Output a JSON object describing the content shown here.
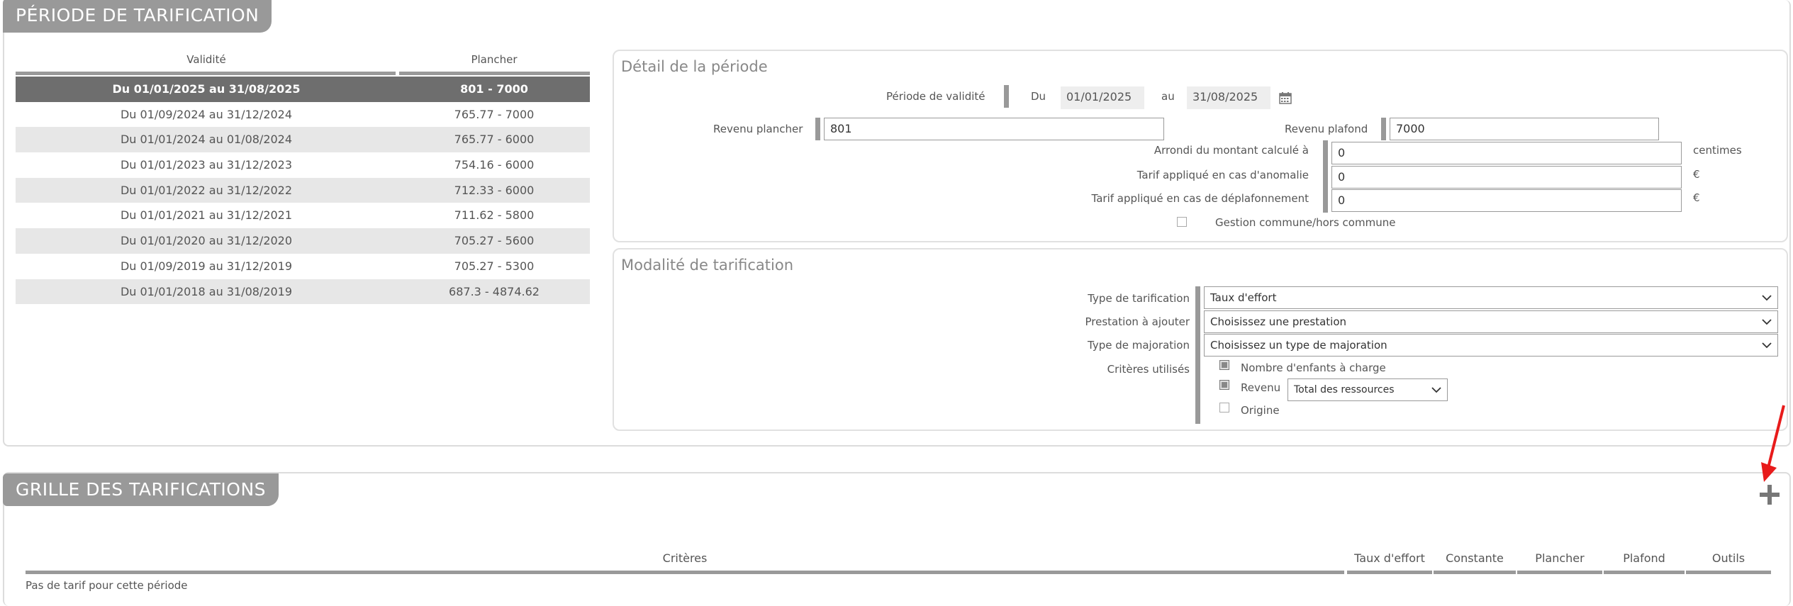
{
  "periode": {
    "tag": "PÉRIODE DE TARIFICATION",
    "table": {
      "col_validite": "Validité",
      "col_plancher": "Plancher",
      "rows": [
        {
          "validite": "Du 01/01/2025 au 31/08/2025",
          "plancher": "801 - 7000",
          "selected": true
        },
        {
          "validite": "Du 01/09/2024 au 31/12/2024",
          "plancher": "765.77 - 7000"
        },
        {
          "validite": "Du 01/01/2024 au 01/08/2024",
          "plancher": "765.77 - 6000"
        },
        {
          "validite": "Du 01/01/2023 au 31/12/2023",
          "plancher": "754.16 - 6000"
        },
        {
          "validite": "Du 01/01/2022 au 31/12/2022",
          "plancher": "712.33 - 6000"
        },
        {
          "validite": "Du 01/01/2021 au 31/12/2021",
          "plancher": "711.62 - 5800"
        },
        {
          "validite": "Du 01/01/2020 au 31/12/2020",
          "plancher": "705.27 - 5600"
        },
        {
          "validite": "Du 01/09/2019 au 31/12/2019",
          "plancher": "705.27 - 5300"
        },
        {
          "validite": "Du 01/01/2018 au 31/08/2019",
          "plancher": "687.3 - 4874.62"
        }
      ]
    },
    "detail": {
      "title": "Détail de la période",
      "validite_label": "Période de validité",
      "du_label": "Du",
      "du_value": "01/01/2025",
      "au_label": "au",
      "au_value": "31/08/2025",
      "revenu_plancher_label": "Revenu plancher",
      "revenu_plancher_value": "801",
      "revenu_plafond_label": "Revenu plafond",
      "revenu_plafond_value": "7000",
      "arrondi_label": "Arrondi du montant calculé à",
      "arrondi_value": "0",
      "arrondi_unit": "centimes",
      "anomalie_label": "Tarif appliqué en cas d'anomalie",
      "anomalie_value": "0",
      "anomalie_unit": "€",
      "deplafonnement_label": "Tarif appliqué en cas de déplafonnement",
      "deplafonnement_value": "0",
      "deplafonnement_unit": "€",
      "gestion_label": "Gestion commune/hors commune"
    },
    "modalite": {
      "title": "Modalité de tarification",
      "type_tarif_label": "Type de tarification",
      "type_tarif_value": "Taux d'effort",
      "prestation_label": "Prestation à ajouter",
      "prestation_value": "Choisissez une prestation",
      "majoration_label": "Type de majoration",
      "majoration_value": "Choisissez un type de majoration",
      "criteres_label": "Critères utilisés",
      "crit_enfants": "Nombre d'enfants à charge",
      "crit_revenu": "Revenu",
      "crit_revenu_select": "Total des ressources",
      "crit_origine": "Origine"
    }
  },
  "grille": {
    "tag": "GRILLE DES TARIFICATIONS",
    "cols": {
      "criteres": "Critères",
      "taux": "Taux d'effort",
      "constante": "Constante",
      "plancher": "Plancher",
      "plafond": "Plafond",
      "outils": "Outils"
    },
    "empty": "Pas de tarif pour cette période"
  },
  "colors": {
    "section_tag": "#999999",
    "selected_row": "#6e6e6e",
    "annotation_arrow": "#e81b1b"
  }
}
